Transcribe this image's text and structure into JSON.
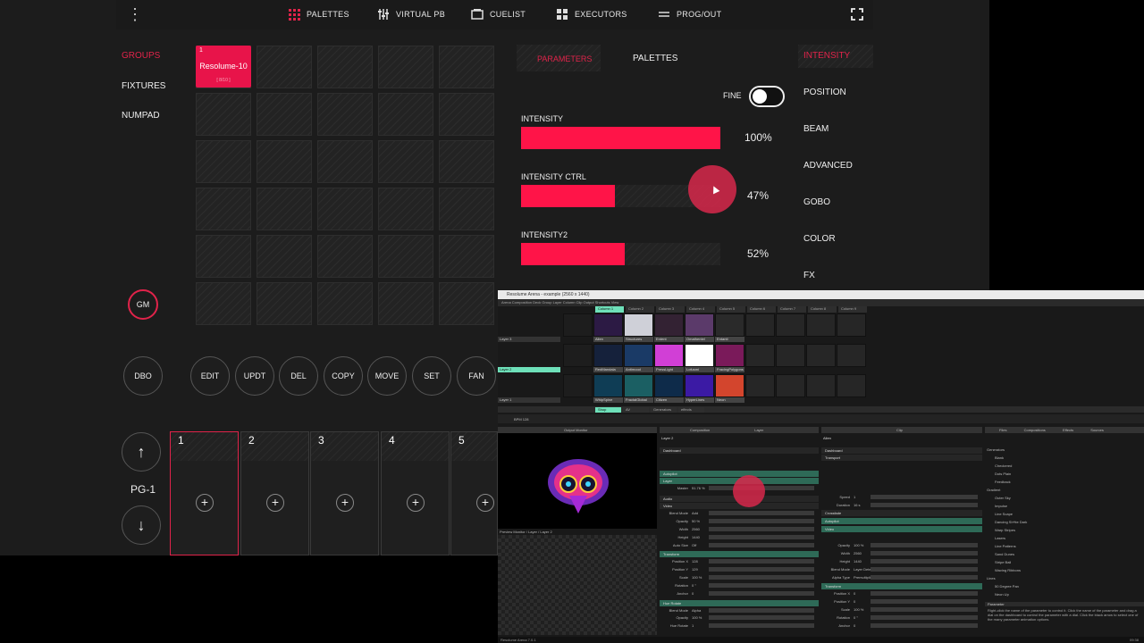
{
  "colors": {
    "accent": "#e0234a",
    "fill": "#ff1448",
    "teal": "#6ee0b9"
  },
  "topbar": {
    "menu_icon": "⋮",
    "items": [
      {
        "label": "PALETTES",
        "icon": "grid-icon"
      },
      {
        "label": "VIRTUAL PB",
        "icon": "sliders-icon"
      },
      {
        "label": "CUELIST",
        "icon": "cuelist-icon"
      },
      {
        "label": "EXECUTORS",
        "icon": "executors-icon"
      },
      {
        "label": "PROG/OUT",
        "icon": "prog-out-icon"
      }
    ],
    "fullscreen_icon": "fullscreen-icon"
  },
  "left_nav": {
    "groups": "GROUPS",
    "fixtures": "FIXTURES",
    "numpad": "NUMPAD"
  },
  "preset": {
    "number": "1",
    "name": "Resolume-10",
    "sub": "[ 8/10 ]"
  },
  "gm_label": "GM",
  "actions": {
    "dbo": "DBO",
    "edit": "EDIT",
    "updt": "UPDT",
    "del": "DEL",
    "copy": "COPY",
    "move": "MOVE",
    "set": "SET",
    "fan": "FAN"
  },
  "playback": {
    "page": "PG-1",
    "up_icon": "↑",
    "down_icon": "↓",
    "plus": "+",
    "columns": [
      "1",
      "2",
      "3",
      "4",
      "5"
    ]
  },
  "param_panel": {
    "tabs": {
      "parameters": "PARAMETERS",
      "palettes": "PALETTES"
    },
    "fine_label": "FINE",
    "fine_on": true,
    "params": [
      {
        "label": "INTENSITY",
        "value": "100%",
        "level": 1.0
      },
      {
        "label": "INTENSITY CTRL",
        "value": "47%",
        "level": 0.47
      },
      {
        "label": "INTENSITY2",
        "value": "52%",
        "level": 0.52
      }
    ]
  },
  "right_nav": {
    "intensity": "INTENSITY",
    "position": "POSITION",
    "beam": "BEAM",
    "advanced": "ADVANCED",
    "gobo": "GOBO",
    "color": "COLOR",
    "fx": "FX"
  },
  "resolume": {
    "title": "Resolume Arena - example (2560 x 1440)",
    "menu": "Arena   Composition   Deck   Group   Layer   Column   Clip   Output   Shortcuts   View",
    "columns": [
      "Column 1",
      "Column 2",
      "Column 3",
      "Column 4",
      "Column 5",
      "Column 6",
      "Column 7",
      "Column 8",
      "Column 9"
    ],
    "layers": [
      "Layer 3",
      "Layer 2",
      "Layer 1"
    ],
    "clips_row1": [
      "Alien",
      "Structures",
      "Entent",
      "Omathentel",
      "Entanti"
    ],
    "clips_row2": [
      "RedMandala",
      "Antimood",
      "PressLight",
      "Lofusmi",
      "FracingPolygons"
    ],
    "clips_row3": [
      "WhipSpine",
      "FractalGlobal",
      "Citizen",
      "HyperLines",
      "Neon"
    ],
    "transport": "BPM  128",
    "decks": [
      "Shop",
      "AV",
      "Generators",
      "effects"
    ],
    "panels": {
      "output": "Output Monitor",
      "composition": "Composition",
      "layer": "Layer",
      "clip": "Clip",
      "files": "Files",
      "compositions": "Compositions",
      "effects": "Effects",
      "sources": "Sources"
    },
    "preview_label": "Preview Monitor / Layer / Layer 2",
    "layer_name": "Layer 2",
    "clip_name": "Alien",
    "layer_sections": [
      "Dashboard",
      "Autopilot",
      "Layer",
      "Audio",
      "Video",
      "Transform",
      "Hue Rotate"
    ],
    "layer_rows": [
      {
        "k": "Master",
        "v": "51.76 %"
      },
      {
        "k": "Blend Mode",
        "v": "Add"
      },
      {
        "k": "Opacity",
        "v": "50 %"
      },
      {
        "k": "Width",
        "v": "2560"
      },
      {
        "k": "Height",
        "v": "1440"
      },
      {
        "k": "Auto Size",
        "v": "Off"
      },
      {
        "k": "Position X",
        "v": "128"
      },
      {
        "k": "Position Y",
        "v": "129"
      },
      {
        "k": "Scale",
        "v": "100 %"
      },
      {
        "k": "Rotation",
        "v": "0 °"
      },
      {
        "k": "Anchor",
        "v": "0"
      },
      {
        "k": "Blend Mode",
        "v": "Alpha"
      },
      {
        "k": "Opacity",
        "v": "100 %"
      },
      {
        "k": "Hue Rotate",
        "v": "1"
      }
    ],
    "clip_sections": [
      "Dashboard",
      "Transport",
      "Crossfade",
      "Autopilot",
      "Video",
      "Transform"
    ],
    "clip_rows": [
      {
        "k": "Speed",
        "v": "1"
      },
      {
        "k": "Duration",
        "v": "16 s"
      },
      {
        "k": "Opacity",
        "v": "100 %"
      },
      {
        "k": "Width",
        "v": "2560"
      },
      {
        "k": "Height",
        "v": "1440"
      },
      {
        "k": "Blend Mode",
        "v": "Layer Determined"
      },
      {
        "k": "Alpha Type",
        "v": "Premultiplied"
      },
      {
        "k": "Position X",
        "v": "0"
      },
      {
        "k": "Position Y",
        "v": "0"
      },
      {
        "k": "Scale",
        "v": "100 %"
      },
      {
        "k": "Rotation",
        "v": "0 °"
      },
      {
        "k": "Anchor",
        "v": "0"
      }
    ],
    "sources": [
      "Generators",
      "Blank",
      "Checkered",
      "Dots Plain",
      "Feedback",
      "Gradient",
      "Outer Sky",
      "Impulse",
      "Line Scape",
      "Dancing Sh*tte Dark",
      "Warp Stripes",
      "Lasers",
      "Line Patterns",
      "Sand Dunes",
      "Stripe Ball",
      "Waving Ribbons",
      "Lines",
      "50 Degree Pan",
      "Neon Up"
    ],
    "parameter_head": "Parameter",
    "parameter_help": "Right-click the name of the parameter to control it. Click the name of the parameter and drag a dial on the dashboard to control the parameter with a dial. Click the black arrow to select one of the many parameter animation options.",
    "status": "Resolume Arena 7.0.1",
    "clock": "09:38"
  }
}
